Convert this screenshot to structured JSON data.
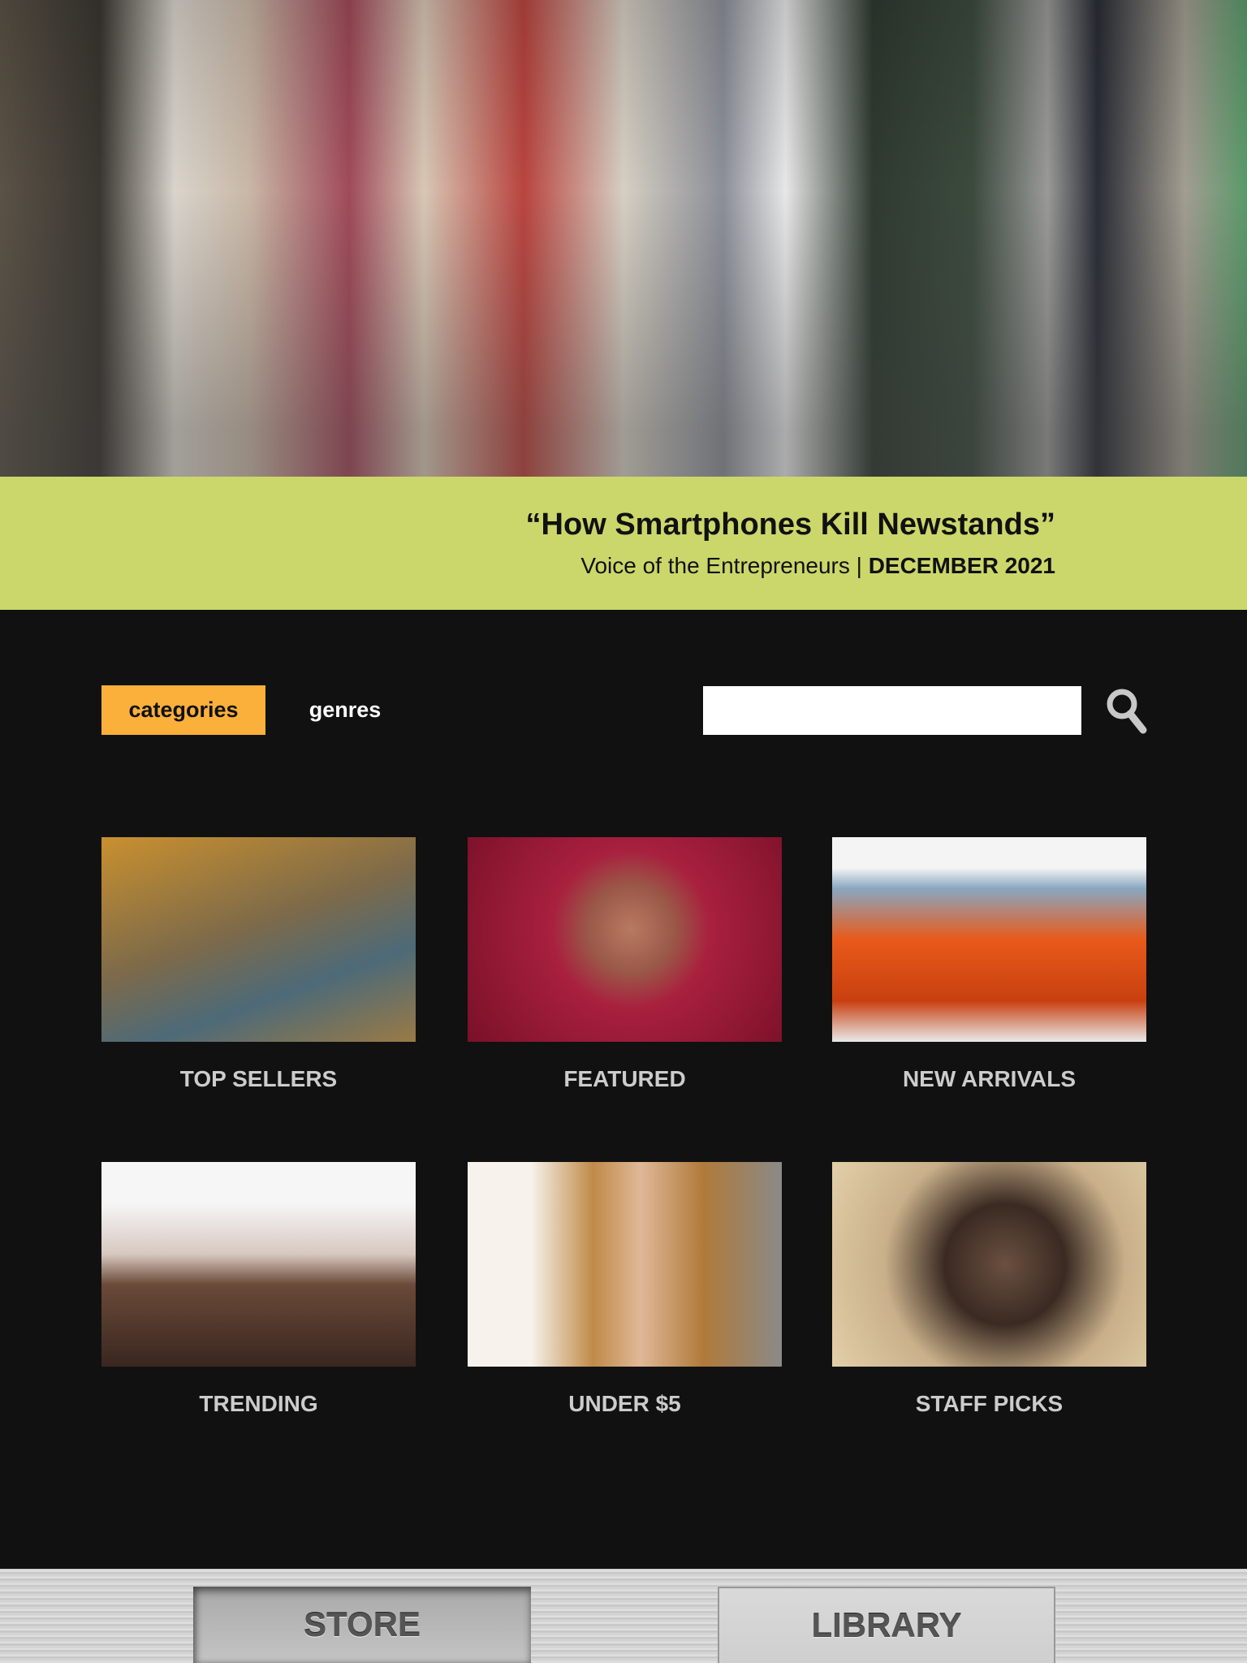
{
  "hero": {
    "image": "newsstand-photo"
  },
  "banner": {
    "title": "“How Smartphones Kill Newstands”",
    "publication": "Voice of the Entrepreneurs | ",
    "date": "DECEMBER 2021"
  },
  "filters": {
    "categories": "categories",
    "genres": "genres"
  },
  "search": {
    "value": "",
    "icon": "search-icon"
  },
  "tiles": [
    {
      "label": "TOP SELLERS"
    },
    {
      "label": "FEATURED"
    },
    {
      "label": "NEW ARRIVALS"
    },
    {
      "label": "TRENDING"
    },
    {
      "label": "UNDER $5"
    },
    {
      "label": "STAFF PICKS"
    }
  ],
  "tabs": {
    "store": "STORE",
    "library": "LIBRARY"
  },
  "colors": {
    "banner": "#cbd76b",
    "accent": "#fbb03b",
    "background": "#111111"
  }
}
